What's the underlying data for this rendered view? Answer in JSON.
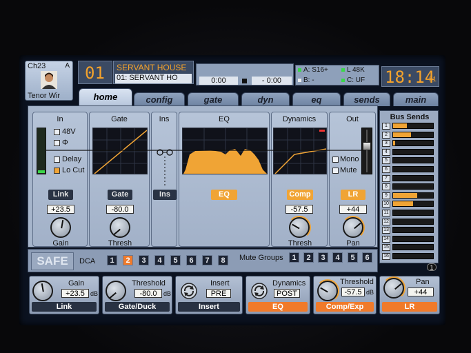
{
  "header": {
    "channel_id": "Ch23",
    "channel_letter": "A",
    "channel_name": "Tenor Wir",
    "channel_number": "01",
    "scene_name": "SERVANT HOUSE",
    "scene_sub": "01: SERVANT HO",
    "time_elapsed": "0:00",
    "time_remaining": "- 0:00",
    "card_a": "A: S16+",
    "card_b": "B:  -",
    "sample_rate": "L  48K",
    "card_c": "C:  UF",
    "clock": "18:14",
    "clock_seconds": "51"
  },
  "tabs": [
    {
      "label": "home"
    },
    {
      "label": "config"
    },
    {
      "label": "gate"
    },
    {
      "label": "dyn"
    },
    {
      "label": "eq"
    },
    {
      "label": "sends"
    },
    {
      "label": "main"
    }
  ],
  "sections": {
    "in": {
      "title": "In",
      "opt_48v": "48V",
      "opt_phase": "Φ",
      "opt_delay": "Delay",
      "opt_locut": "Lo Cut",
      "link_label": "Link",
      "gain_value": "+23.5",
      "knob_label": "Gain"
    },
    "gate": {
      "title": "Gate",
      "button": "Gate",
      "thresh_value": "-80.0",
      "knob_label": "Thresh"
    },
    "ins": {
      "title": "Ins",
      "button": "Ins"
    },
    "eq": {
      "title": "EQ",
      "button": "EQ"
    },
    "dynamics": {
      "title": "Dynamics",
      "button": "Comp",
      "thresh_value": "-57.5",
      "knob_label": "Thresh"
    },
    "out": {
      "title": "Out",
      "opt_mono": "Mono",
      "opt_mute": "Mute",
      "button": "LR",
      "pan_value": "+44",
      "knob_label": "Pan"
    }
  },
  "bottom_bar": {
    "safe": "SAFE",
    "dca_label": "DCA",
    "dca": [
      {
        "n": "1",
        "on": false
      },
      {
        "n": "2",
        "on": true
      },
      {
        "n": "3",
        "on": false
      },
      {
        "n": "4",
        "on": false
      },
      {
        "n": "5",
        "on": false
      },
      {
        "n": "6",
        "on": false
      },
      {
        "n": "7",
        "on": false
      },
      {
        "n": "8",
        "on": false
      }
    ],
    "mute_groups_label": "Mute Groups",
    "mute_groups": [
      "1",
      "2",
      "3",
      "4",
      "5",
      "6"
    ]
  },
  "bus_sends": {
    "title": "Bus Sends",
    "page_indicator": "1",
    "levels": [
      0.35,
      0.45,
      0.05,
      0,
      0,
      0,
      0,
      0,
      0.6,
      0.5,
      0,
      0,
      0,
      0,
      0,
      0
    ],
    "numbers": [
      "1",
      "2",
      "3",
      "4",
      "5",
      "6",
      "7",
      "8",
      "9",
      "10",
      "11",
      "12",
      "13",
      "14",
      "15",
      "16"
    ]
  },
  "encoders": {
    "gain": {
      "label": "Gain",
      "value": "+23.5",
      "unit": "dB",
      "footer": "Link"
    },
    "threshold": {
      "label": "Threshold",
      "value": "-80.0",
      "unit": "dB",
      "footer": "Gate/Duck"
    },
    "insert": {
      "label": "Insert",
      "value": "PRE",
      "footer": "Insert"
    },
    "dynamics": {
      "label": "Dynamics",
      "value": "POST",
      "footer": "EQ"
    },
    "comp_threshold": {
      "label": "Threshold",
      "value": "-57.5",
      "unit": "dB",
      "footer": "Comp/Exp"
    },
    "pan": {
      "label": "Pan",
      "value": "+44",
      "footer": "LR"
    }
  },
  "colors": {
    "accent": "#f0a435",
    "panel": "#a6b5cb",
    "dark": "#283142"
  }
}
